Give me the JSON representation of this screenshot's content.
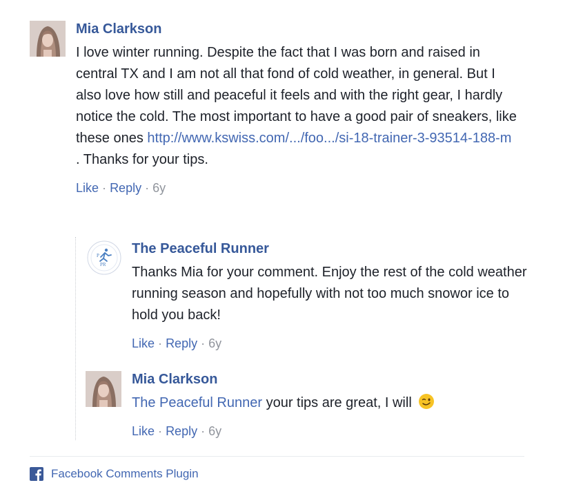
{
  "comments": [
    {
      "author": "Mia Clarkson",
      "text_before": "I love winter running. Despite the fact that I was born and raised in central TX and I am not all that fond of cold weather, in general. But I also love how still and peaceful it feels and with the right gear, I hardly notice the cold. The most important to have a good pair of sneakers, like these ones ",
      "link": "http://www.kswiss.com/.../foo.../si-18-trainer-3-93514-188-m",
      "text_after": " . Thanks for your tips.",
      "like": "Like",
      "reply": "Reply",
      "sep": "·",
      "time": "6y",
      "avatar": "user-photo"
    },
    {
      "author": "The Peaceful Runner",
      "text": "Thanks Mia for your comment. Enjoy the rest of the cold weather running season and hopefully with not too much snowor ice to hold you back!",
      "like": "Like",
      "reply": "Reply",
      "sep": "·",
      "time": "6y",
      "avatar": "runner-logo"
    },
    {
      "author": "Mia Clarkson",
      "mention": "The Peaceful Runner",
      "text": " your tips are great, I will ",
      "emoji": "winking-face",
      "like": "Like",
      "reply": "Reply",
      "sep": "·",
      "time": "6y",
      "avatar": "user-photo"
    }
  ],
  "footer": {
    "label": "Facebook Comments Plugin",
    "icon": "facebook-icon"
  },
  "colors": {
    "name": "#365899",
    "link": "#4267b2",
    "meta": "#90949c",
    "text": "#1d2129"
  }
}
